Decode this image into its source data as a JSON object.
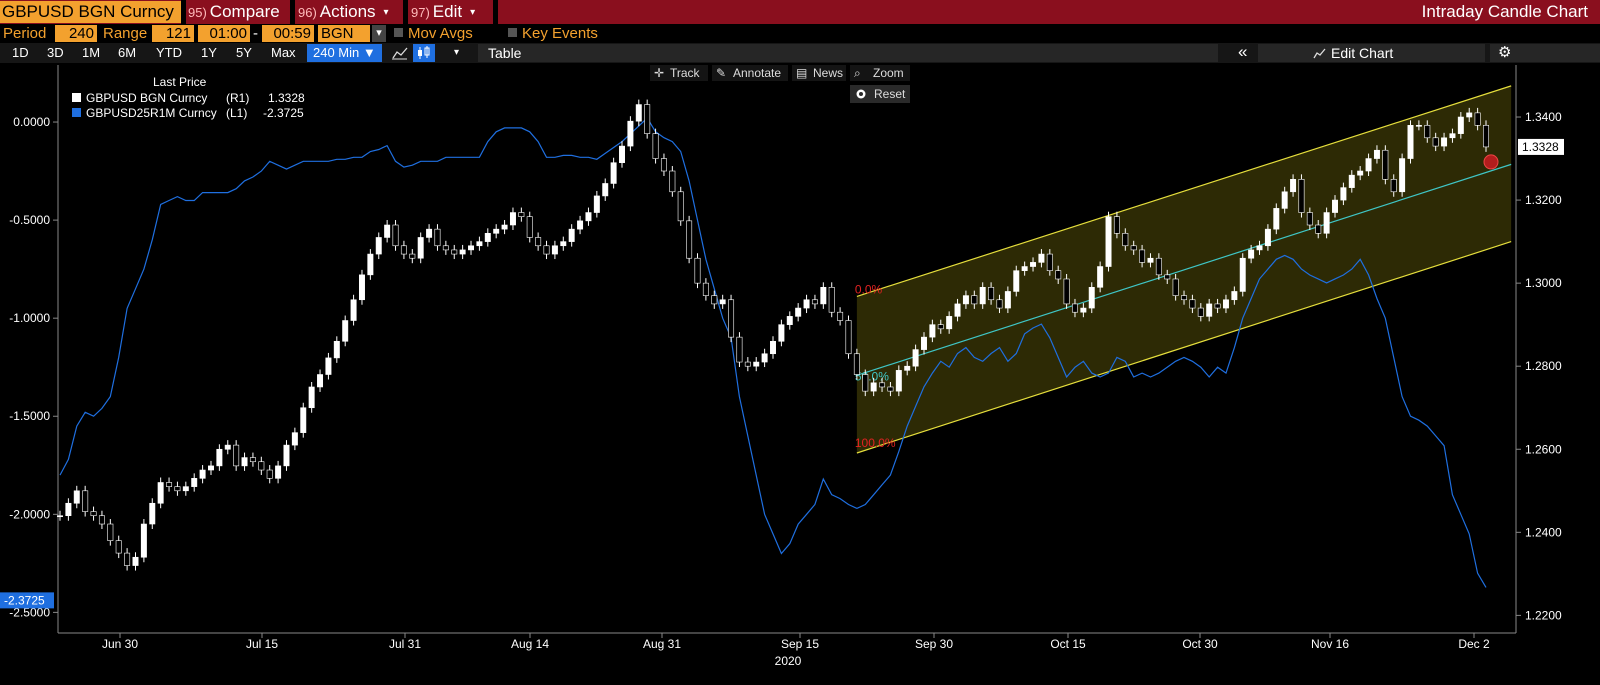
{
  "titlebar": {
    "security": "GBPUSD BGN Curncy",
    "compare_fn": "95)",
    "compare": "Compare",
    "actions_fn": "96)",
    "actions": "Actions",
    "edit_fn": "97)",
    "edit": "Edit",
    "caret": "▾",
    "function_title": "Intraday Candle Chart"
  },
  "params": {
    "period_label": "Period",
    "period": "240",
    "range_label": "Range",
    "range": "121",
    "start_time": "01:00",
    "dash": "-",
    "end_time": "00:59",
    "source": "BGN",
    "source_caret": "▾",
    "mov_avgs": "Mov Avgs",
    "key_events": "Key Events"
  },
  "toolbar": {
    "ranges": [
      "1D",
      "3D",
      "1M",
      "6M",
      "YTD",
      "1Y",
      "5Y",
      "Max"
    ],
    "interval": "240 Min ▼",
    "table": "Table",
    "collapse": "«",
    "edit_chart": "Edit Chart",
    "settings": "⚙",
    "dropdown": "▾"
  },
  "chart_tools": {
    "track": "Track",
    "annotate": "Annotate",
    "news": "News",
    "zoom": "Zoom",
    "reset": "Reset"
  },
  "legend": {
    "title": "Last Price",
    "entries": [
      {
        "name": "GBPUSD BGN Curncy",
        "axis": "(R1)",
        "value": "1.3328",
        "color": "#ffffff"
      },
      {
        "name": "GBPUSD25R1M Curncy",
        "axis": "(L1)",
        "value": "-2.3725",
        "color": "#1f6fe0"
      }
    ]
  },
  "colors": {
    "spot": "#ffffff",
    "risk_reversal": "#1f6fe0",
    "channel": "#e5de3c",
    "channel_fill": "#2f2c05",
    "midline": "#3fc6c6",
    "channel_label": "#e22222",
    "mid_label": "#3fc6c6"
  },
  "chart_data": {
    "type": "line",
    "x": [
      "Jun 30",
      "Jul 15",
      "Jul 31",
      "Aug 14",
      "Aug 31",
      "Sep 15",
      "Sep 30",
      "Oct 15",
      "Oct 30",
      "Nov 16",
      "Dec 2"
    ],
    "year_label": "2020",
    "left_axis": {
      "ticks": [
        "0.0000",
        "-0.5000",
        "-1.0000",
        "-1.5000",
        "-2.0000",
        "-2.5000"
      ],
      "ylim": [
        -2.6,
        0.25
      ],
      "last_label": "-2.3725"
    },
    "right_axis": {
      "ticks": [
        "1.3400",
        "1.3200",
        "1.3000",
        "1.2800",
        "1.2600",
        "1.2400",
        "1.2200"
      ],
      "ylim": [
        1.216,
        1.3506
      ],
      "last_label": "1.3328"
    },
    "series": [
      {
        "name": "GBPUSD BGN Curncy",
        "axis": "right",
        "values": [
          1.244,
          1.247,
          1.25,
          1.245,
          1.244,
          1.242,
          1.238,
          1.235,
          1.232,
          1.234,
          1.242,
          1.247,
          1.252,
          1.251,
          1.25,
          1.251,
          1.253,
          1.255,
          1.256,
          1.26,
          1.261,
          1.256,
          1.258,
          1.257,
          1.255,
          1.253,
          1.256,
          1.261,
          1.264,
          1.27,
          1.275,
          1.278,
          1.282,
          1.286,
          1.291,
          1.296,
          1.302,
          1.307,
          1.311,
          1.314,
          1.309,
          1.307,
          1.306,
          1.311,
          1.313,
          1.309,
          1.308,
          1.307,
          1.308,
          1.309,
          1.31,
          1.312,
          1.313,
          1.314,
          1.317,
          1.316,
          1.311,
          1.309,
          1.307,
          1.309,
          1.31,
          1.313,
          1.315,
          1.317,
          1.321,
          1.324,
          1.329,
          1.333,
          1.339,
          1.343,
          1.336,
          1.33,
          1.327,
          1.322,
          1.315,
          1.306,
          1.3,
          1.297,
          1.295,
          1.296,
          1.287,
          1.281,
          1.28,
          1.281,
          1.283,
          1.286,
          1.29,
          1.292,
          1.294,
          1.296,
          1.295,
          1.299,
          1.293,
          1.291,
          1.283,
          1.278,
          1.274,
          1.276,
          1.275,
          1.274,
          1.279,
          1.28,
          1.284,
          1.287,
          1.29,
          1.289,
          1.292,
          1.295,
          1.297,
          1.295,
          1.299,
          1.296,
          1.294,
          1.298,
          1.303,
          1.304,
          1.305,
          1.307,
          1.303,
          1.301,
          1.295,
          1.293,
          1.294,
          1.299,
          1.304,
          1.316,
          1.312,
          1.309,
          1.308,
          1.305,
          1.306,
          1.302,
          1.301,
          1.297,
          1.296,
          1.294,
          1.292,
          1.295,
          1.294,
          1.296,
          1.298,
          1.306,
          1.308,
          1.309,
          1.313,
          1.318,
          1.322,
          1.325,
          1.317,
          1.314,
          1.312,
          1.317,
          1.32,
          1.323,
          1.326,
          1.327,
          1.33,
          1.332,
          1.325,
          1.322,
          1.33,
          1.338,
          1.338,
          1.335,
          1.333,
          1.335,
          1.336,
          1.34,
          1.341,
          1.338,
          1.3328
        ]
      },
      {
        "name": "GBPUSD25R1M Curncy",
        "axis": "left",
        "values": [
          -1.8,
          -1.72,
          -1.55,
          -1.48,
          -1.5,
          -1.46,
          -1.4,
          -1.2,
          -0.95,
          -0.85,
          -0.75,
          -0.6,
          -0.42,
          -0.4,
          -0.38,
          -0.4,
          -0.4,
          -0.36,
          -0.36,
          -0.36,
          -0.36,
          -0.34,
          -0.3,
          -0.28,
          -0.25,
          -0.2,
          -0.22,
          -0.24,
          -0.22,
          -0.2,
          -0.2,
          -0.2,
          -0.2,
          -0.19,
          -0.19,
          -0.18,
          -0.18,
          -0.15,
          -0.14,
          -0.12,
          -0.2,
          -0.23,
          -0.22,
          -0.2,
          -0.2,
          -0.2,
          -0.18,
          -0.18,
          -0.18,
          -0.18,
          -0.18,
          -0.1,
          -0.05,
          -0.03,
          -0.03,
          -0.03,
          -0.05,
          -0.1,
          -0.18,
          -0.18,
          -0.17,
          -0.17,
          -0.18,
          -0.18,
          -0.19,
          -0.16,
          -0.13,
          -0.1,
          -0.06,
          -0.02,
          0.02,
          -0.05,
          -0.08,
          -0.1,
          -0.15,
          -0.3,
          -0.5,
          -0.7,
          -0.85,
          -1.0,
          -1.1,
          -1.4,
          -1.6,
          -1.8,
          -2.0,
          -2.1,
          -2.2,
          -2.15,
          -2.05,
          -2.0,
          -1.95,
          -1.82,
          -1.9,
          -1.92,
          -1.95,
          -1.97,
          -1.95,
          -1.9,
          -1.85,
          -1.8,
          -1.68,
          -1.55,
          -1.45,
          -1.35,
          -1.28,
          -1.22,
          -1.25,
          -1.18,
          -1.15,
          -1.2,
          -1.22,
          -1.18,
          -1.15,
          -1.22,
          -1.18,
          -1.08,
          -1.05,
          -1.03,
          -1.1,
          -1.2,
          -1.3,
          -1.25,
          -1.22,
          -1.28,
          -1.3,
          -1.28,
          -1.2,
          -1.22,
          -1.3,
          -1.28,
          -1.3,
          -1.28,
          -1.25,
          -1.22,
          -1.2,
          -1.22,
          -1.25,
          -1.3,
          -1.25,
          -1.28,
          -1.15,
          -1.0,
          -0.9,
          -0.8,
          -0.75,
          -0.7,
          -0.68,
          -0.7,
          -0.75,
          -0.78,
          -0.8,
          -0.82,
          -0.8,
          -0.78,
          -0.75,
          -0.7,
          -0.78,
          -0.9,
          -1.0,
          -1.2,
          -1.4,
          -1.5,
          -1.52,
          -1.55,
          -1.6,
          -1.65,
          -1.9,
          -2.0,
          -2.1,
          -2.3,
          -2.3725
        ]
      }
    ],
    "channel": {
      "start_index": 95,
      "end_index": 173,
      "top": [
        1.2968,
        1.3475
      ],
      "mid": [
        1.2778,
        1.3286
      ],
      "bottom": [
        1.2591,
        1.31
      ],
      "labels": {
        "top": "0.0%",
        "mid": "50.0%",
        "bottom": "100.0%"
      }
    },
    "grid": false,
    "legend_position": "top-left"
  }
}
